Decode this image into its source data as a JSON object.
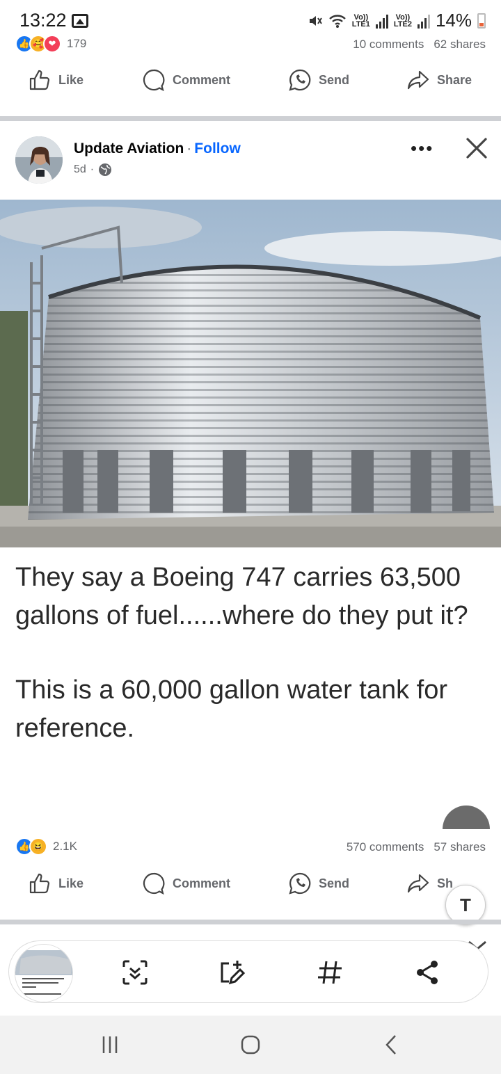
{
  "status_bar": {
    "time": "13:22",
    "net1": "Vo))\nLTE1",
    "net2": "Vo))\nLTE2",
    "battery": "14%"
  },
  "prev_post": {
    "reaction_count": "179",
    "comments": "10 comments",
    "shares": "62 shares",
    "actions": {
      "like": "Like",
      "comment": "Comment",
      "send": "Send",
      "share": "Share"
    }
  },
  "post": {
    "page_name": "Update Aviation",
    "follow": "Follow",
    "age": "5d",
    "caption_line1": "They say a Boeing 747 carries 63,500 gallons of fuel......where do they put it?",
    "caption_line2": "This is a 60,000 gallon water tank for reference.",
    "reaction_count": "2.1K",
    "comments": "570 comments",
    "shares": "57 shares",
    "actions": {
      "like": "Like",
      "comment": "Comment",
      "send": "Send",
      "share": "Sh"
    }
  },
  "colors": {
    "accent": "#0866ff",
    "like_blue": "#1877f2",
    "love_red": "#f33e58",
    "muted": "#65676b",
    "divider": "#ced0d4"
  },
  "toolbar": {
    "icons": [
      "scan-icon",
      "edit-add-icon",
      "hashtag-icon",
      "share-icon"
    ],
    "text_fab": "T"
  }
}
